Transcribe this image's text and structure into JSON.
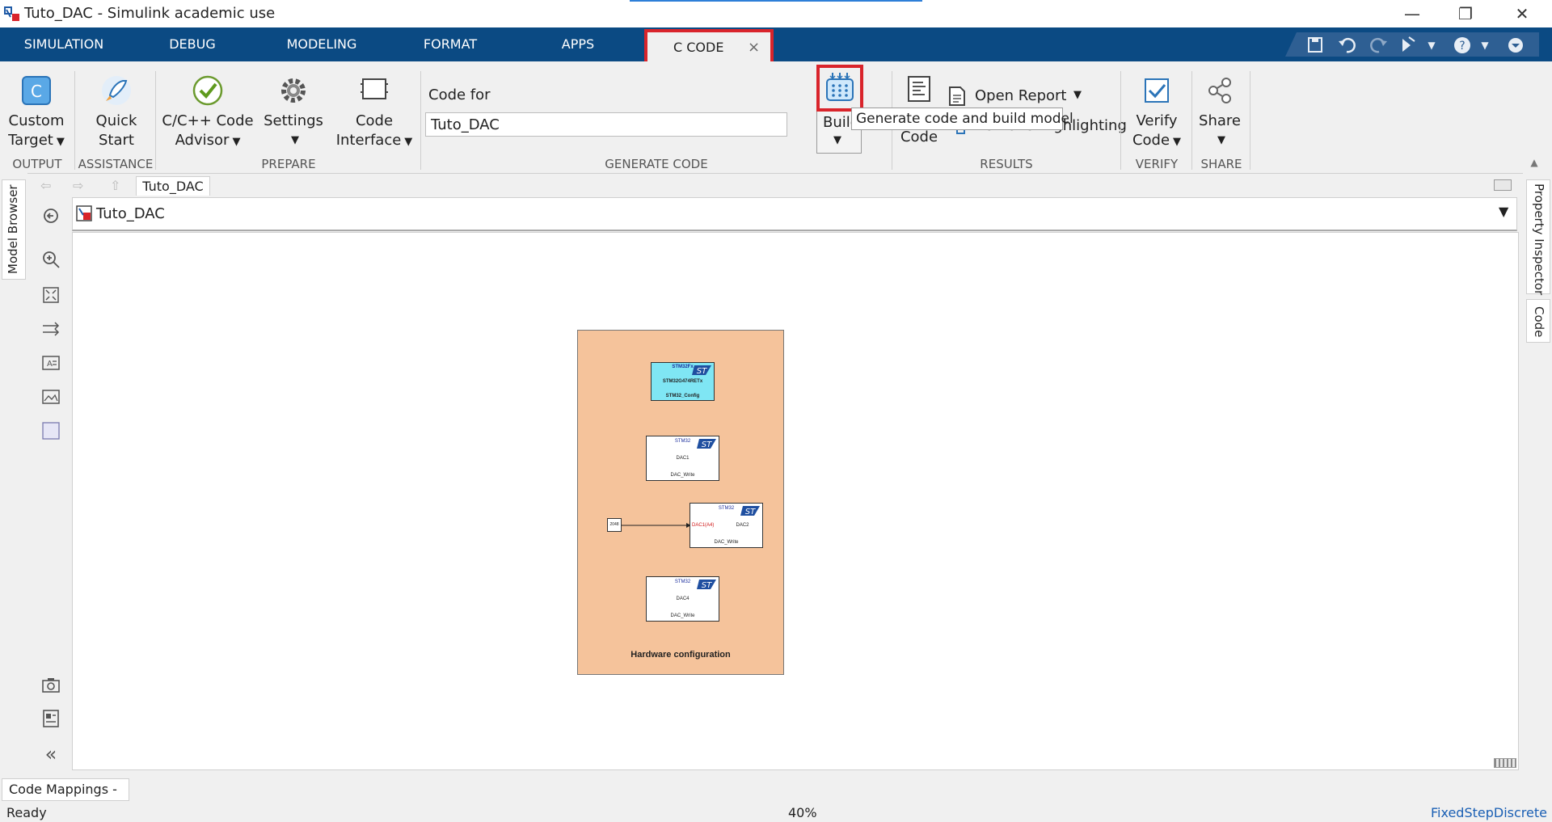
{
  "window": {
    "title": "Tuto_DAC - Simulink academic use",
    "minimize_glyph": "—",
    "restore_glyph": "❐",
    "close_glyph": "✕"
  },
  "tabs": [
    {
      "label": "SIMULATION"
    },
    {
      "label": "DEBUG"
    },
    {
      "label": "MODELING"
    },
    {
      "label": "FORMAT"
    },
    {
      "label": "APPS"
    },
    {
      "label": "C CODE",
      "active": true,
      "close_glyph": "×"
    }
  ],
  "quick_access": [
    "save-icon",
    "undo-icon",
    "redo-icon",
    "run-icon",
    "help-icon",
    "more-icon"
  ],
  "ribbon": {
    "custom_target": {
      "line1": "Custom",
      "line2": "Target"
    },
    "quick_start": {
      "line1": "Quick",
      "line2": "Start"
    },
    "code_advisor": {
      "line1": "C/C++ Code",
      "line2": "Advisor"
    },
    "settings": {
      "line1": "Settings"
    },
    "code_interface": {
      "line1": "Code",
      "line2": "Interface"
    },
    "code_for_label": "Code for",
    "code_for_value": "Tuto_DAC",
    "build_label": "Build",
    "build_tooltip": "Generate code and build model",
    "code_view": {
      "line2": "Code"
    },
    "open_report": "Open Report",
    "remove_highlighting": "Remove Highlighting",
    "verify_code": {
      "line1": "Verify",
      "line2": "Code"
    },
    "share": {
      "line1": "Share"
    },
    "sections": {
      "output": "OUTPUT",
      "assistance": "ASSISTANCE",
      "prepare": "PREPARE",
      "generate_code": "GENERATE CODE",
      "results": "RESULTS",
      "verify": "VERIFY",
      "share": "SHARE"
    },
    "caret": "▼"
  },
  "left_dock": {
    "model_browser": "Model Browser"
  },
  "right_dock": {
    "property_inspector": "Property Inspector",
    "code": "Code"
  },
  "editor": {
    "breadcrumb_tab": "Tuto_DAC",
    "address": "Tuto_DAC"
  },
  "model": {
    "area_label": "Hardware configuration",
    "config_block": {
      "top": "STM32Fx",
      "middle": "STM32G474RETx",
      "bottom": "STM32_Config"
    },
    "dac1_block": {
      "top": "STM32",
      "middle": "DAC1",
      "bottom": "DAC_Write"
    },
    "dac2_block": {
      "top": "STM32",
      "port": "DAC1(A4)",
      "middle": "DAC2",
      "bottom": "DAC_Write"
    },
    "dac4_block": {
      "top": "STM32",
      "middle": "DAC4",
      "bottom": "DAC_Write"
    },
    "constant_block": {
      "value": "2048"
    }
  },
  "bottom": {
    "mapping_tab": "Code Mappings - C",
    "status": "Ready",
    "zoom": "40%",
    "solver": "FixedStepDiscrete"
  },
  "colors": {
    "tabstrip": "#0b4a83",
    "highlight": "#d9242b",
    "hw_area": "#f5c39b",
    "config_block": "#7fe6f4",
    "solver_link": "#1a5fb4"
  }
}
